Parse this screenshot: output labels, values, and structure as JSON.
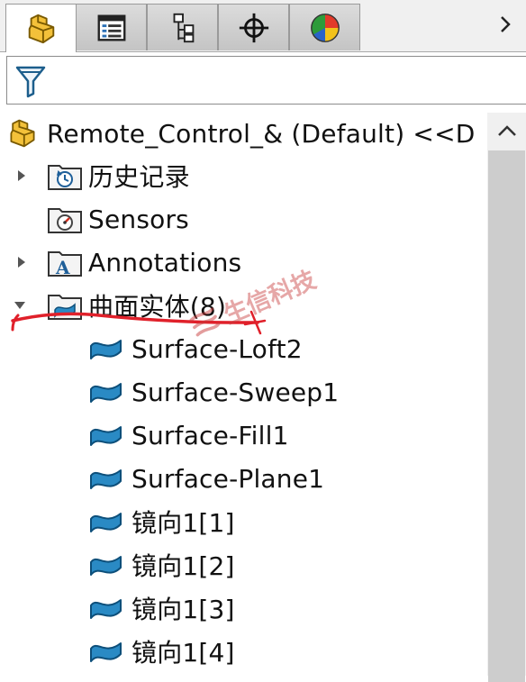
{
  "tabs": [
    {
      "name": "feature-manager",
      "icon": "part-icon",
      "active": true
    },
    {
      "name": "property-manager",
      "icon": "property-list-icon"
    },
    {
      "name": "configuration-manager",
      "icon": "configuration-icon"
    },
    {
      "name": "dimxpert-manager",
      "icon": "crosshair-icon"
    },
    {
      "name": "display-manager",
      "icon": "color-pie-icon"
    }
  ],
  "tab_scroll_icon": "chevron-right-icon",
  "filter": {
    "icon": "funnel-filter-icon"
  },
  "tree": {
    "root": {
      "label": "Remote_Control_& (Default) <<D",
      "icon": "part-icon"
    },
    "history": {
      "label": "历史记录",
      "icon": "history-folder-icon"
    },
    "sensors": {
      "label": "Sensors",
      "icon": "sensors-folder-icon"
    },
    "annotations": {
      "label": "Annotations",
      "icon": "annotations-folder-icon"
    },
    "surface_bodies": {
      "label": "曲面实体(8)",
      "icon": "surface-bodies-folder-icon",
      "expanded": true,
      "items": [
        {
          "label": "Surface-Loft2",
          "icon": "surface-body-icon"
        },
        {
          "label": "Surface-Sweep1",
          "icon": "surface-body-icon"
        },
        {
          "label": "Surface-Fill1",
          "icon": "surface-body-icon"
        },
        {
          "label": "Surface-Plane1",
          "icon": "surface-body-icon"
        },
        {
          "label": "镜向1[1]",
          "icon": "surface-body-icon"
        },
        {
          "label": "镜向1[2]",
          "icon": "surface-body-icon"
        },
        {
          "label": "镜向1[3]",
          "icon": "surface-body-icon"
        },
        {
          "label": "镜向1[4]",
          "icon": "surface-body-icon"
        }
      ]
    }
  },
  "scrollbar": {
    "up_icon": "chevron-up-icon"
  },
  "watermark": {
    "text": "生信科技"
  },
  "colors": {
    "annotation_stroke": "#e0202a",
    "surface_icon": "#2a8ac4"
  }
}
